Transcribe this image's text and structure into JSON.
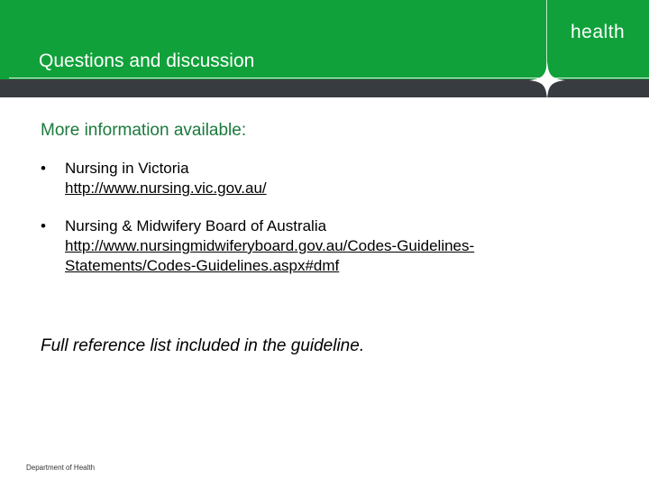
{
  "header": {
    "title": "Questions and discussion",
    "brand": "health",
    "colors": {
      "green": "#10a13a",
      "dark_bar": "#383c40"
    },
    "icon": "sparkle-star-icon"
  },
  "content": {
    "subheading": "More information available:",
    "bullets": [
      {
        "label": "Nursing in Victoria",
        "link_lines": [
          "http://www.nursing.vic.gov.au/"
        ]
      },
      {
        "label": "Nursing & Midwifery Board of Australia",
        "link_lines": [
          "http://www.nursingmidwiferyboard.gov.au/Codes-Guidelines-",
          "Statements/Codes-Guidelines.aspx#dmf"
        ]
      }
    ],
    "note": "Full reference list included in the guideline."
  },
  "footer": {
    "department": "Department of Health"
  }
}
